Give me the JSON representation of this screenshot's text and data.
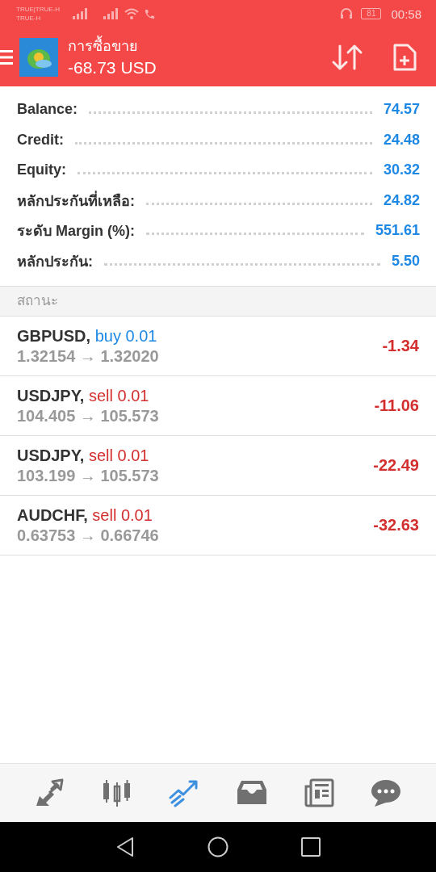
{
  "status_bar": {
    "carrier_top": "TRUE|TRUE-H",
    "carrier_bottom": "TRUE-H",
    "battery": "81",
    "time": "00:58"
  },
  "header": {
    "title": "การซื้อขาย",
    "subtitle": "-68.73 USD"
  },
  "summary": [
    {
      "label": "Balance:",
      "value": "74.57"
    },
    {
      "label": "Credit:",
      "value": "24.48"
    },
    {
      "label": "Equity:",
      "value": "30.32"
    },
    {
      "label": "หลักประกันที่เหลือ:",
      "value": "24.82"
    },
    {
      "label": "ระดับ Margin (%):",
      "value": "551.61"
    },
    {
      "label": "หลักประกัน:",
      "value": "5.50"
    }
  ],
  "section_title": "สถานะ",
  "positions": [
    {
      "symbol": "GBPUSD,",
      "kind": "buy",
      "order": "buy 0.01",
      "prices": "1.32154 → 1.32020",
      "profit": "-1.34"
    },
    {
      "symbol": "USDJPY,",
      "kind": "sell",
      "order": "sell 0.01",
      "prices": "104.405 → 105.573",
      "profit": "-11.06"
    },
    {
      "symbol": "USDJPY,",
      "kind": "sell",
      "order": "sell 0.01",
      "prices": "103.199 → 105.573",
      "profit": "-22.49"
    },
    {
      "symbol": "AUDCHF,",
      "kind": "sell",
      "order": "sell 0.01",
      "prices": "0.63753 → 0.66746",
      "profit": "-32.63"
    }
  ],
  "bottom_nav": [
    {
      "kind": "quotes",
      "selected": false
    },
    {
      "kind": "chart",
      "selected": false
    },
    {
      "kind": "trade",
      "selected": true
    },
    {
      "kind": "history",
      "selected": false
    },
    {
      "kind": "news",
      "selected": false
    },
    {
      "kind": "chat",
      "selected": false
    }
  ]
}
